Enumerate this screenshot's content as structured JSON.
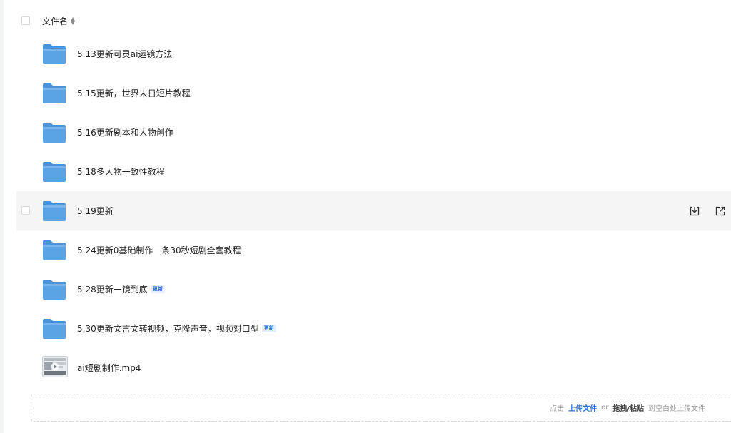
{
  "header": {
    "column_label": "文件名",
    "sort_icon": "sort-icon"
  },
  "files": [
    {
      "name": "5.13更新可灵ai运镜方法",
      "type": "folder",
      "badge": ""
    },
    {
      "name": "5.15更新，世界末日短片教程",
      "type": "folder",
      "badge": ""
    },
    {
      "name": "5.16更新剧本和人物创作",
      "type": "folder",
      "badge": ""
    },
    {
      "name": "5.18多人物一致性教程",
      "type": "folder",
      "badge": ""
    },
    {
      "name": "5.19更新",
      "type": "folder",
      "badge": "",
      "hovered": true
    },
    {
      "name": "5.24更新0基础制作一条30秒短剧全套教程",
      "type": "folder",
      "badge": ""
    },
    {
      "name": "5.28更新一镜到底",
      "type": "folder",
      "badge": "更新"
    },
    {
      "name": "5.30更新文言文转视频，克隆声音，视频对口型",
      "type": "folder",
      "badge": "更新"
    },
    {
      "name": "ai短剧制作.mp4",
      "type": "video",
      "badge": ""
    }
  ],
  "row_actions": {
    "download_icon": "download-icon",
    "share_icon": "share-icon"
  },
  "upload": {
    "prefix": "点击",
    "link": "上传文件",
    "or": "or",
    "drag": "拖拽/粘贴",
    "suffix": "到空白处上传文件"
  },
  "colors": {
    "folder": "#5aa4e6",
    "accent": "#2d6bd6",
    "hover_row": "#f5f5f6"
  }
}
